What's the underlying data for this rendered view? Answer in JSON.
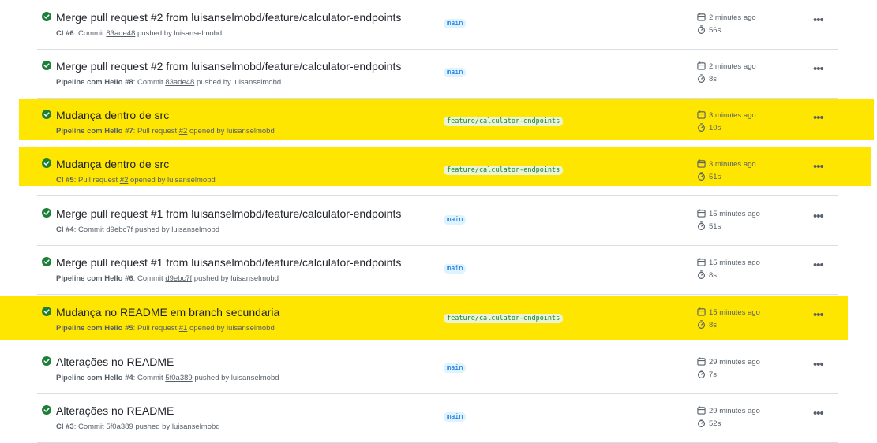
{
  "runs": [
    {
      "title": "Merge pull request #2 from luisanselmobd/feature/calculator-endpoints",
      "workflow": "CI #6",
      "sep": ": ",
      "kind": "Commit",
      "ref": "83ade48",
      "action": "pushed by luisanselmobd",
      "branch": "main",
      "feature": false,
      "highlight": false,
      "time": "2 minutes ago",
      "duration": "56s"
    },
    {
      "title": "Merge pull request #2 from luisanselmobd/feature/calculator-endpoints",
      "workflow": "Pipeline com Hello #8",
      "sep": ": ",
      "kind": "Commit",
      "ref": "83ade48",
      "action": "pushed by luisanselmobd",
      "branch": "main",
      "feature": false,
      "highlight": false,
      "time": "2 minutes ago",
      "duration": "8s"
    },
    {
      "title": "Mudança dentro de src",
      "workflow": "Pipeline com Hello #7",
      "sep": ": ",
      "kind": "Pull request",
      "ref": "#2",
      "action": "opened by luisanselmobd",
      "branch": "feature/calculator-endpoints",
      "feature": true,
      "highlight": true,
      "time": "3 minutes ago",
      "duration": "10s"
    },
    {
      "title": "Mudança dentro de src",
      "workflow": "CI #5",
      "sep": ": ",
      "kind": "Pull request",
      "ref": "#2",
      "action": "opened by luisanselmobd",
      "branch": "feature/calculator-endpoints",
      "feature": true,
      "highlight": true,
      "time": "3 minutes ago",
      "duration": "51s"
    },
    {
      "title": "Merge pull request #1 from luisanselmobd/feature/calculator-endpoints",
      "workflow": "CI #4",
      "sep": ": ",
      "kind": "Commit",
      "ref": "d9ebc7f",
      "action": "pushed by luisanselmobd",
      "branch": "main",
      "feature": false,
      "highlight": false,
      "time": "15 minutes ago",
      "duration": "51s"
    },
    {
      "title": "Merge pull request #1 from luisanselmobd/feature/calculator-endpoints",
      "workflow": "Pipeline com Hello #6",
      "sep": ": ",
      "kind": "Commit",
      "ref": "d9ebc7f",
      "action": "pushed by luisanselmobd",
      "branch": "main",
      "feature": false,
      "highlight": false,
      "time": "15 minutes ago",
      "duration": "8s"
    },
    {
      "title": "Mudança no README em branch secundaria",
      "workflow": "Pipeline com Hello #5",
      "sep": ": ",
      "kind": "Pull request",
      "ref": "#1",
      "action": "opened by luisanselmobd",
      "branch": "feature/calculator-endpoints",
      "feature": true,
      "highlight": true,
      "time": "15 minutes ago",
      "duration": "8s"
    },
    {
      "title": "Alterações no README",
      "workflow": "Pipeline com Hello #4",
      "sep": ": ",
      "kind": "Commit",
      "ref": "5f0a389",
      "action": "pushed by luisanselmobd",
      "branch": "main",
      "feature": false,
      "highlight": false,
      "time": "29 minutes ago",
      "duration": "7s"
    },
    {
      "title": "Alterações no README",
      "workflow": "CI #3",
      "sep": ": ",
      "kind": "Commit",
      "ref": "5f0a389",
      "action": "pushed by luisanselmobd",
      "branch": "main",
      "feature": false,
      "highlight": false,
      "time": "29 minutes ago",
      "duration": "52s"
    }
  ],
  "colors": {
    "success": "#1a7f37",
    "highlight": "#ffe600",
    "branch_main_bg": "#ddf4ff",
    "branch_feature_bg": "#eaf5d7"
  },
  "icons": {
    "status": "check-circle-icon",
    "date": "calendar-icon",
    "duration": "stopwatch-icon",
    "menu": "kebab-icon"
  }
}
